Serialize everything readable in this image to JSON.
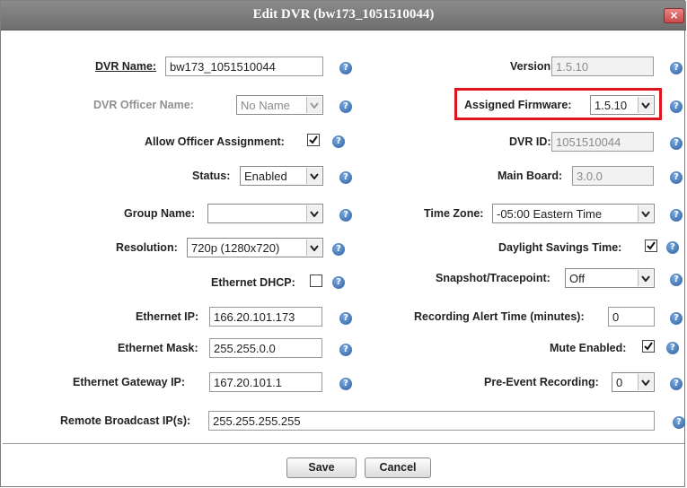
{
  "dialog": {
    "title": "Edit DVR (bw173_1051510044)",
    "close_label": "×"
  },
  "left": {
    "dvr_name_label": "DVR Name:",
    "dvr_name_value": "bw173_1051510044",
    "officer_name_label": "DVR Officer Name:",
    "officer_name_value": "No Name",
    "allow_assignment_label": "Allow Officer Assignment:",
    "allow_assignment_checked": true,
    "status_label": "Status:",
    "status_value": "Enabled",
    "group_name_label": "Group Name:",
    "group_name_value": "",
    "resolution_label": "Resolution:",
    "resolution_value": "720p (1280x720)",
    "ethernet_dhcp_label": "Ethernet DHCP:",
    "ethernet_dhcp_checked": false,
    "ethernet_ip_label": "Ethernet IP:",
    "ethernet_ip_value": "166.20.101.173",
    "ethernet_mask_label": "Ethernet Mask:",
    "ethernet_mask_value": "255.255.0.0",
    "gateway_label": "Ethernet Gateway IP:",
    "gateway_value": "167.20.101.1"
  },
  "right": {
    "version_label": "Version:",
    "version_value": "1.5.10",
    "firmware_label": "Assigned Firmware:",
    "firmware_value": "1.5.10",
    "dvr_id_label": "DVR ID:",
    "dvr_id_value": "1051510044",
    "main_board_label": "Main Board:",
    "main_board_value": "3.0.0",
    "time_zone_label": "Time Zone:",
    "time_zone_value": "-05:00 Eastern Time",
    "dst_label": "Daylight Savings Time:",
    "dst_checked": true,
    "snapshot_label": "Snapshot/Tracepoint:",
    "snapshot_value": "Off",
    "alert_time_label": "Recording Alert Time (minutes):",
    "alert_time_value": "0",
    "mute_label": "Mute Enabled:",
    "mute_checked": true,
    "pre_event_label": "Pre-Event Recording:",
    "pre_event_value": "0"
  },
  "remote": {
    "label": "Remote Broadcast IP(s):",
    "value": "255.255.255.255"
  },
  "buttons": {
    "save": "Save",
    "cancel": "Cancel"
  },
  "help_glyph": "?",
  "colors": {
    "highlight": "#e0141e",
    "help_icon": "#2b5f9e",
    "titlebar": "#7a7a7a"
  }
}
